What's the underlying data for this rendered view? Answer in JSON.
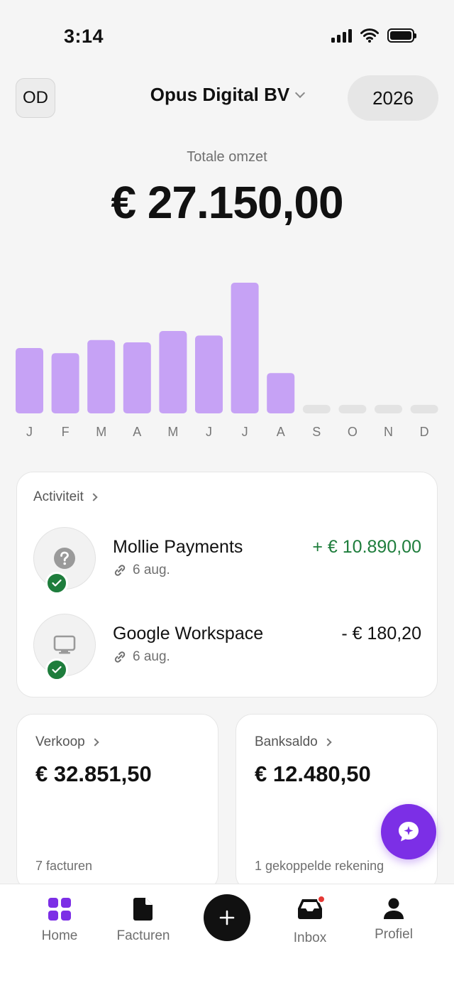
{
  "status_bar": {
    "time": "3:14"
  },
  "header": {
    "avatar_initials": "OD",
    "company": "Opus Digital BV",
    "year": "2026"
  },
  "revenue": {
    "label": "Totale omzet",
    "amount": "€ 27.150,00"
  },
  "chart_data": {
    "type": "bar",
    "categories": [
      "J",
      "F",
      "M",
      "A",
      "M",
      "J",
      "J",
      "A",
      "S",
      "O",
      "N",
      "D"
    ],
    "values": [
      1150,
      1060,
      1290,
      1250,
      1450,
      1370,
      2300,
      710,
      0,
      0,
      0,
      0
    ],
    "bar_color": "#c6a2f5",
    "empty_color": "#e3e3e3",
    "ylim": [
      0,
      2300
    ],
    "grid": false
  },
  "activity": {
    "heading": "Activiteit",
    "items": [
      {
        "name": "Mollie Payments",
        "date": "6 aug.",
        "amount": "+ € 10.890,00",
        "direction": "in",
        "icon": "question-icon"
      },
      {
        "name": "Google Workspace",
        "date": "6 aug.",
        "amount": "- € 180,20",
        "direction": "out",
        "icon": "monitor-icon"
      }
    ]
  },
  "summary": {
    "sales": {
      "heading": "Verkoop",
      "value": "€ 32.851,50",
      "footer": "7 facturen"
    },
    "bank": {
      "heading": "Banksaldo",
      "value": "€ 12.480,50",
      "footer": "1 gekoppelde rekening"
    }
  },
  "nav": {
    "home": "Home",
    "invoices": "Facturen",
    "inbox": "Inbox",
    "profile": "Profiel"
  },
  "colors": {
    "accent": "#7c2fe6",
    "positive": "#1e7d3c",
    "notification": "#e53935"
  }
}
